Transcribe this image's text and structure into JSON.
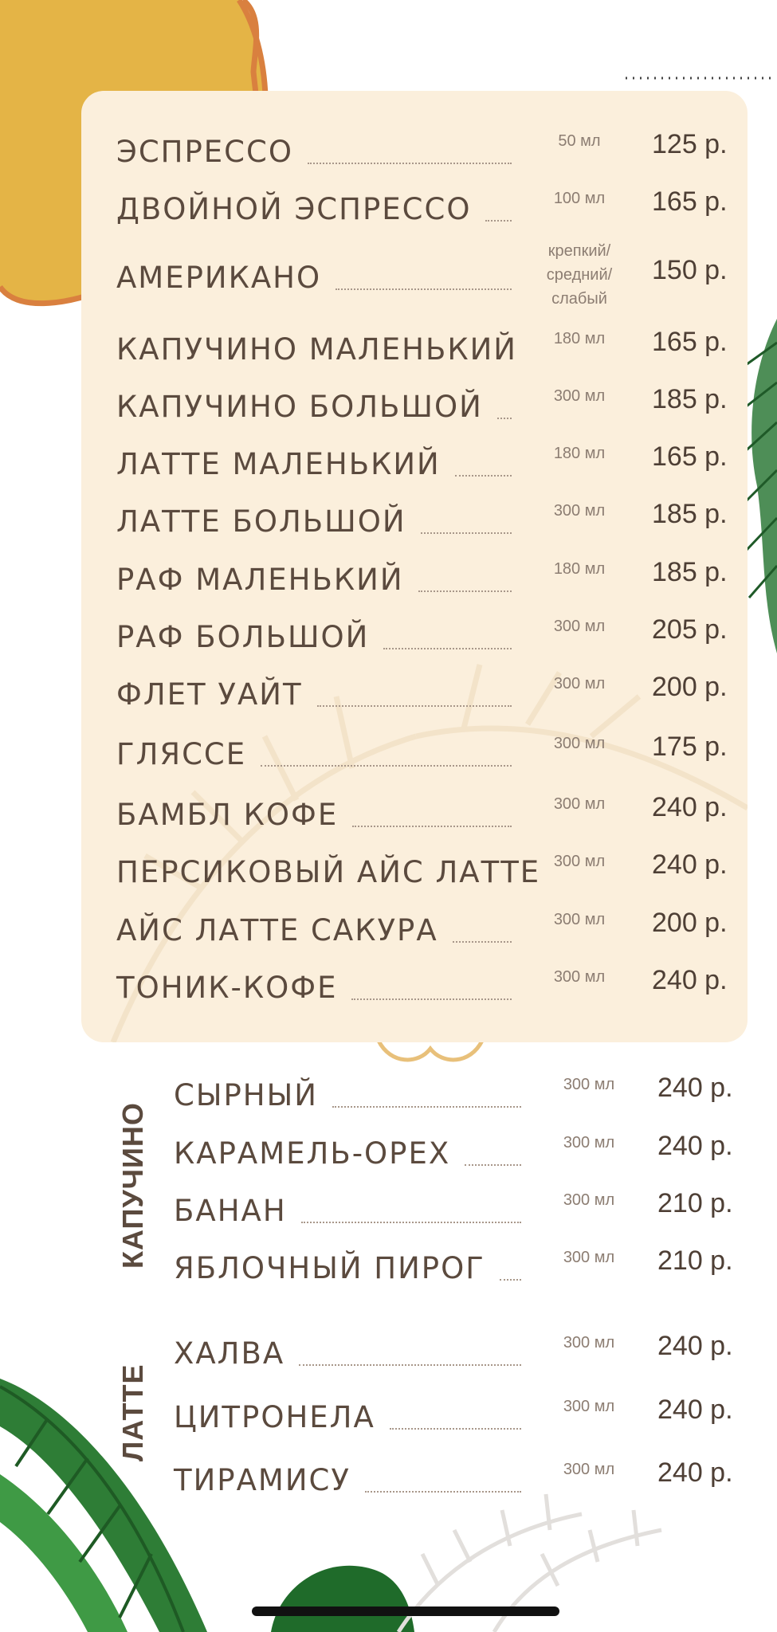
{
  "classic": [
    {
      "name": "ЭСПРЕССО",
      "volume": "50 мл",
      "price": "125 р."
    },
    {
      "name": "ДВОЙНОЙ ЭСПРЕССО",
      "volume": "100 мл",
      "price": "165 р."
    },
    {
      "name": "АМЕРИКАНО",
      "volume": "крепкий/ средний/ слабый",
      "price": "150 р."
    },
    {
      "name": "КАПУЧИНО МАЛЕНЬКИЙ",
      "volume": "180 мл",
      "price": "165 р."
    },
    {
      "name": "КАПУЧИНО БОЛЬШОЙ",
      "volume": "300 мл",
      "price": "185 р."
    },
    {
      "name": "ЛАТТЕ МАЛЕНЬКИЙ",
      "volume": "180 мл",
      "price": "165 р."
    },
    {
      "name": "ЛАТТЕ БОЛЬШОЙ",
      "volume": "300 мл",
      "price": "185 р."
    },
    {
      "name": "РАФ МАЛЕНЬКИЙ",
      "volume": "180 мл",
      "price": "185 р."
    },
    {
      "name": "РАФ БОЛЬШОЙ",
      "volume": "300 мл",
      "price": "205 р."
    },
    {
      "name": "ФЛЕТ УАЙТ",
      "volume": "300 мл",
      "price": "200 р."
    },
    {
      "name": "ГЛЯССЕ",
      "volume": "300 мл",
      "price": "175 р."
    },
    {
      "name": "БАМБЛ КОФЕ",
      "volume": "300 мл",
      "price": "240 р."
    },
    {
      "name": "ПЕРСИКОВЫЙ АЙС ЛАТТЕ",
      "volume": "300 мл",
      "price": "240 р."
    },
    {
      "name": "АЙС ЛАТТЕ САКУРА",
      "volume": "300 мл",
      "price": "200 р."
    },
    {
      "name": "ТОНИК-КОФЕ",
      "volume": "300 мл",
      "price": "240 р."
    }
  ],
  "cappuccino": {
    "label": "КАПУЧИНО",
    "items": [
      {
        "name": "СЫРНЫЙ",
        "volume": "300 мл",
        "price": "240 р."
      },
      {
        "name": "КАРАМЕЛЬ-ОРЕХ",
        "volume": "300 мл",
        "price": "240 р."
      },
      {
        "name": "БАНАН",
        "volume": "300 мл",
        "price": "210 р."
      },
      {
        "name": "ЯБЛОЧНЫЙ ПИРОГ",
        "volume": "300 мл",
        "price": "210 р."
      }
    ]
  },
  "latte": {
    "label": "ЛАТТЕ",
    "items": [
      {
        "name": "ХАЛВА",
        "volume": "300 мл",
        "price": "240 р."
      },
      {
        "name": "ЦИТРОНЕЛА",
        "volume": "300 мл",
        "price": "240 р."
      },
      {
        "name": "ТИРАМИСУ",
        "volume": "300 мл",
        "price": "240 р."
      }
    ]
  },
  "colors": {
    "card": "#fbefdc",
    "text": "#5b4a3e",
    "accent_yellow": "#e4b446",
    "accent_orange": "#d9803f",
    "leaf": "#2f7a3a"
  }
}
